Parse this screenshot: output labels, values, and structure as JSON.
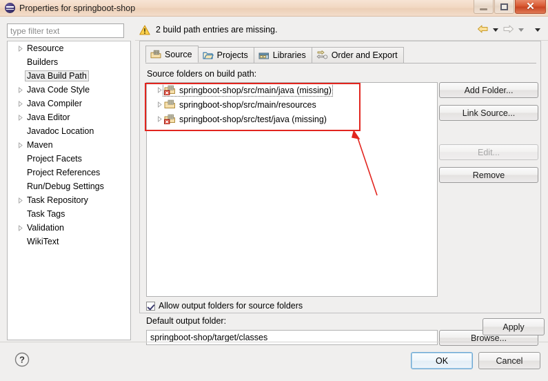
{
  "window": {
    "title": "Properties for springboot-shop",
    "icon": "eclipse-properties-icon",
    "minimize_label": "Minimize",
    "maximize_label": "Maximize",
    "close_label": "✕"
  },
  "filter": {
    "placeholder": "type filter text",
    "value": ""
  },
  "sidebar": {
    "items": [
      {
        "label": "Resource",
        "expandable": true,
        "selected": false
      },
      {
        "label": "Builders",
        "expandable": false,
        "selected": false
      },
      {
        "label": "Java Build Path",
        "expandable": false,
        "selected": true
      },
      {
        "label": "Java Code Style",
        "expandable": true,
        "selected": false
      },
      {
        "label": "Java Compiler",
        "expandable": true,
        "selected": false
      },
      {
        "label": "Java Editor",
        "expandable": true,
        "selected": false
      },
      {
        "label": "Javadoc Location",
        "expandable": false,
        "selected": false
      },
      {
        "label": "Maven",
        "expandable": true,
        "selected": false
      },
      {
        "label": "Project Facets",
        "expandable": false,
        "selected": false
      },
      {
        "label": "Project References",
        "expandable": false,
        "selected": false
      },
      {
        "label": "Run/Debug Settings",
        "expandable": false,
        "selected": false
      },
      {
        "label": "Task Repository",
        "expandable": true,
        "selected": false
      },
      {
        "label": "Task Tags",
        "expandable": false,
        "selected": false
      },
      {
        "label": "Validation",
        "expandable": true,
        "selected": false
      },
      {
        "label": "WikiText",
        "expandable": false,
        "selected": false
      }
    ]
  },
  "header": {
    "warning_text": "2 build path entries are missing.",
    "warning_icon": "warning-triangle-icon",
    "back_icon": "back-arrow-icon",
    "forward_icon": "forward-arrow-icon",
    "menu_icon": "chevron-down-icon"
  },
  "tabs": [
    {
      "label": "Source",
      "icon": "source-folder-icon",
      "active": true
    },
    {
      "label": "Projects",
      "icon": "projects-folder-icon",
      "active": false
    },
    {
      "label": "Libraries",
      "icon": "libraries-jar-icon",
      "active": false
    },
    {
      "label": "Order and Export",
      "icon": "order-export-icon",
      "active": false
    }
  ],
  "source_tab": {
    "section_label": "Source folders on build path:",
    "entries": [
      {
        "label": "springboot-shop/src/main/java (missing)",
        "missing": true,
        "focused": true
      },
      {
        "label": "springboot-shop/src/main/resources",
        "missing": false,
        "focused": false
      },
      {
        "label": "springboot-shop/src/test/java (missing)",
        "missing": true,
        "focused": false
      }
    ],
    "buttons": [
      {
        "label": "Add Folder...",
        "enabled": true
      },
      {
        "label": "Link Source...",
        "enabled": true
      },
      {
        "label": "Edit...",
        "enabled": false
      },
      {
        "label": "Remove",
        "enabled": true
      }
    ],
    "allow_output_label": "Allow output folders for source folders",
    "allow_output_checked": true,
    "default_output_label": "Default output folder:",
    "default_output_value": "springboot-shop/target/classes",
    "browse_label": "Browse..."
  },
  "footer": {
    "apply_label": "Apply",
    "ok_label": "OK",
    "cancel_label": "Cancel",
    "help_icon": "help-question-icon"
  },
  "annotation": {
    "box_color": "#e2251f",
    "arrow_color": "#e2251f"
  },
  "colors": {
    "titlebar": "#f2d8c3",
    "dialog_bg": "#f0efee",
    "warning": "#f2b417",
    "error_badge": "#cc2222",
    "focus_blue": "#6fa8d4"
  }
}
